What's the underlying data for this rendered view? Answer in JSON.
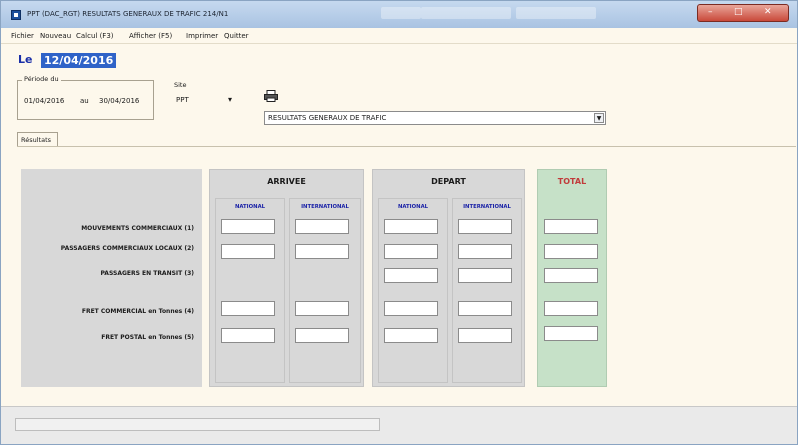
{
  "window": {
    "title": "PPT (DAC_RGT) RESULTATS GENERAUX DE TRAFIC 214/N1"
  },
  "menu": [
    "Fichier",
    "Nouveau",
    "Calcul (F3)",
    "Afficher (F5)",
    "Imprimer",
    "Quitter"
  ],
  "header": {
    "date_label": "Le",
    "date_value": "12/04/2016"
  },
  "period": {
    "title": "Période du",
    "from": "01/04/2016",
    "to_label": "au",
    "to": "30/04/2016"
  },
  "site": {
    "label": "Site",
    "value": "PPT"
  },
  "report": {
    "value": "RESULTATS GENERAUX DE TRAFIC"
  },
  "tabs": [
    "Résultats"
  ],
  "rows": [
    "MOUVEMENTS COMMERCIAUX (1)",
    "PASSAGERS COMMERCIAUX LOCAUX (2)",
    "PASSAGERS EN TRANSIT (3)",
    "FRET COMMERCIAL en Tonnes (4)",
    "FRET POSTAL en Tonnes (5)"
  ],
  "groups": {
    "arrivee": {
      "title": "ARRIVEE",
      "col1": "NATIONAL",
      "col2": "INTERNATIONAL"
    },
    "depart": {
      "title": "DEPART",
      "col1": "NATIONAL",
      "col2": "INTERNATIONAL"
    },
    "total": {
      "title": "TOTAL"
    }
  },
  "colors": {
    "label_panel": "#d8d8d8",
    "total_panel": "#c6e1c8",
    "column_header": "#1b23a7",
    "total_title": "#c13b3b",
    "date_highlight": "#2f63c8"
  },
  "icons": {
    "app": "app-icon",
    "print": "printer-icon",
    "dropdown": "chevron-down-icon"
  }
}
